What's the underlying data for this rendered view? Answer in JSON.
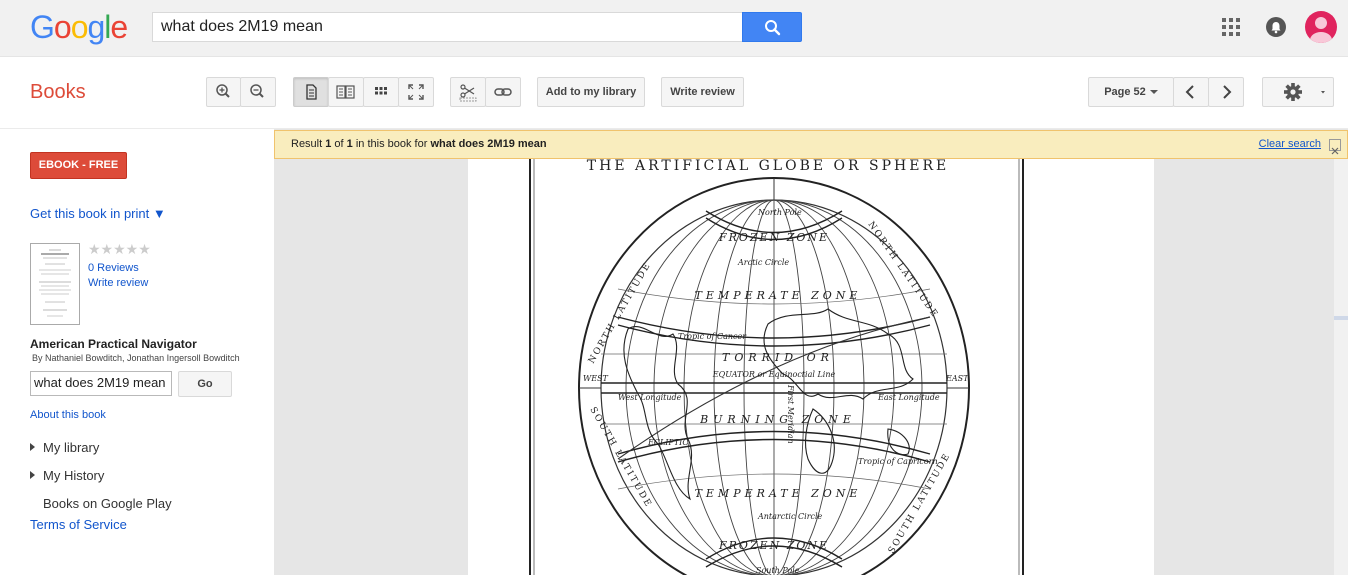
{
  "topbar": {
    "logo_letters": [
      "G",
      "o",
      "o",
      "g",
      "l",
      "e"
    ],
    "logo_colors": [
      "#4285f4",
      "#ea4335",
      "#fbbc05",
      "#4285f4",
      "#34a853",
      "#ea4335"
    ],
    "search_value": "what does 2M19 mean",
    "icons": [
      "search-icon",
      "apps-grid-icon",
      "notifications-bell-icon",
      "account-avatar-icon"
    ]
  },
  "header": {
    "section_title": "Books",
    "add_library_label": "Add to my library",
    "write_review_label": "Write review",
    "page_label": "Page 52",
    "icons": [
      "zoom-in-icon",
      "zoom-out-icon",
      "single-page-icon",
      "two-page-icon",
      "thumbnail-grid-icon",
      "fullscreen-icon",
      "clip-scissors-icon",
      "link-icon",
      "prev-page-icon",
      "next-page-icon",
      "settings-gear-icon"
    ]
  },
  "sidebar": {
    "ebook_label": "EBOOK - FREE",
    "get_print_label": "Get this book in print ▼",
    "stars": "★★★★★",
    "reviews_label": "0 Reviews",
    "write_review_label": "Write review",
    "book_title": "American Practical Navigator",
    "book_authors": "By Nathaniel Bowditch, Jonathan Ingersoll Bowditch",
    "search_value": "what does 2M19 mean",
    "go_label": "Go",
    "about_label": "About this book",
    "my_library_label": "My library",
    "my_history_label": "My History",
    "books_play_label": "Books on Google Play",
    "terms_label": "Terms of Service"
  },
  "viewer": {
    "result_prefix": "Result ",
    "result_num": "1",
    "result_of": " of ",
    "result_total": "1",
    "result_mid": " in this book for ",
    "result_query": "what does 2M19 mean",
    "clear_search_label": "Clear search",
    "page_heading": "THE ARTIFICIAL GLOBE OR SPHERE",
    "globe_labels": {
      "north_lat_left": "NORTH LATITUDE",
      "north_lat_right": "NORTH LATITUDE",
      "south_lat_left": "SOUTH LATITUDE",
      "south_lat_right": "SOUTH LATITUDE",
      "frozen_top": "FROZEN ZONE",
      "arctic": "Arctic Circle",
      "temperate_top": "TEMPERATE ZONE",
      "tropic_cancer": "Tropic of Cancer",
      "torrid": "TORRID OR",
      "equator": "EQUATOR or Equinoctial Line",
      "west": "WEST",
      "east": "EAST",
      "west_long": "West Longitude",
      "east_long": "East Longitude",
      "burning": "BURNING ZONE",
      "ecliptic": "ECLIPTIC",
      "first_meridian": "First Meridian",
      "tropic_capricorn": "Tropic of Capricorn",
      "temperate_bottom": "TEMPERATE ZONE",
      "antarctic": "Antarctic Circle",
      "frozen_bottom": "FROZEN ZONE",
      "south_pole": "South Pole",
      "north_pole": "North Pole"
    }
  }
}
